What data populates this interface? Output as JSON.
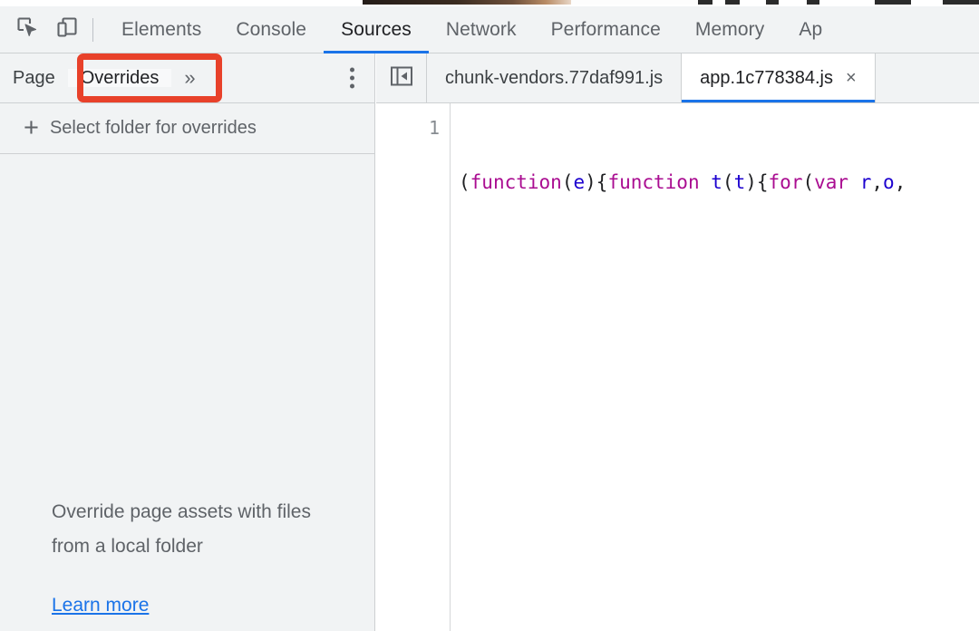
{
  "main_toolbar": {
    "inspect_icon": "inspect-cursor-icon",
    "device_toggle_icon": "device-toolbar-icon",
    "tabs": [
      {
        "label": "Elements",
        "selected": false
      },
      {
        "label": "Console",
        "selected": false
      },
      {
        "label": "Sources",
        "selected": true
      },
      {
        "label": "Network",
        "selected": false
      },
      {
        "label": "Performance",
        "selected": false
      },
      {
        "label": "Memory",
        "selected": false
      },
      {
        "label": "Ap",
        "selected": false
      }
    ],
    "accent_color": "#1a73e8"
  },
  "sidebar": {
    "tabs": [
      {
        "label": "Page",
        "active": false
      },
      {
        "label": "Overrides",
        "active": true
      }
    ],
    "more_tabs_glyph": "»",
    "kebab_icon": "more-options-icon",
    "select_folder": {
      "plus_glyph": "+",
      "label": "Select folder for overrides"
    },
    "empty_state": {
      "message": "Override page assets with files from a local folder",
      "link_label": "Learn more",
      "link_color": "#1a73e8"
    }
  },
  "annotation": {
    "color": "#e8412a",
    "target": "Overrides"
  },
  "editor": {
    "navigator_toggle_icon": "show-navigator-icon",
    "tabs": [
      {
        "label": "chunk-vendors.77daf991.js",
        "active": false,
        "closable": false
      },
      {
        "label": "app.1c778384.js",
        "active": true,
        "closable": true,
        "close_glyph": "×"
      }
    ],
    "gutter": {
      "line_numbers": [
        "1"
      ]
    },
    "code": {
      "line_1_tokens": [
        {
          "t": "(",
          "k": "pun"
        },
        {
          "t": "function",
          "k": "kw"
        },
        {
          "t": "(",
          "k": "pun"
        },
        {
          "t": "e",
          "k": "var"
        },
        {
          "t": ")",
          "k": "pun"
        },
        {
          "t": "{",
          "k": "pun"
        },
        {
          "t": "function",
          "k": "kw"
        },
        {
          "t": " ",
          "k": "pun"
        },
        {
          "t": "t",
          "k": "var"
        },
        {
          "t": "(",
          "k": "pun"
        },
        {
          "t": "t",
          "k": "var"
        },
        {
          "t": ")",
          "k": "pun"
        },
        {
          "t": "{",
          "k": "pun"
        },
        {
          "t": "for",
          "k": "kw"
        },
        {
          "t": "(",
          "k": "pun"
        },
        {
          "t": "var",
          "k": "kw"
        },
        {
          "t": " ",
          "k": "pun"
        },
        {
          "t": "r",
          "k": "var"
        },
        {
          "t": ",",
          "k": "pun"
        },
        {
          "t": "o",
          "k": "var"
        },
        {
          "t": ",",
          "k": "pun"
        }
      ]
    }
  }
}
